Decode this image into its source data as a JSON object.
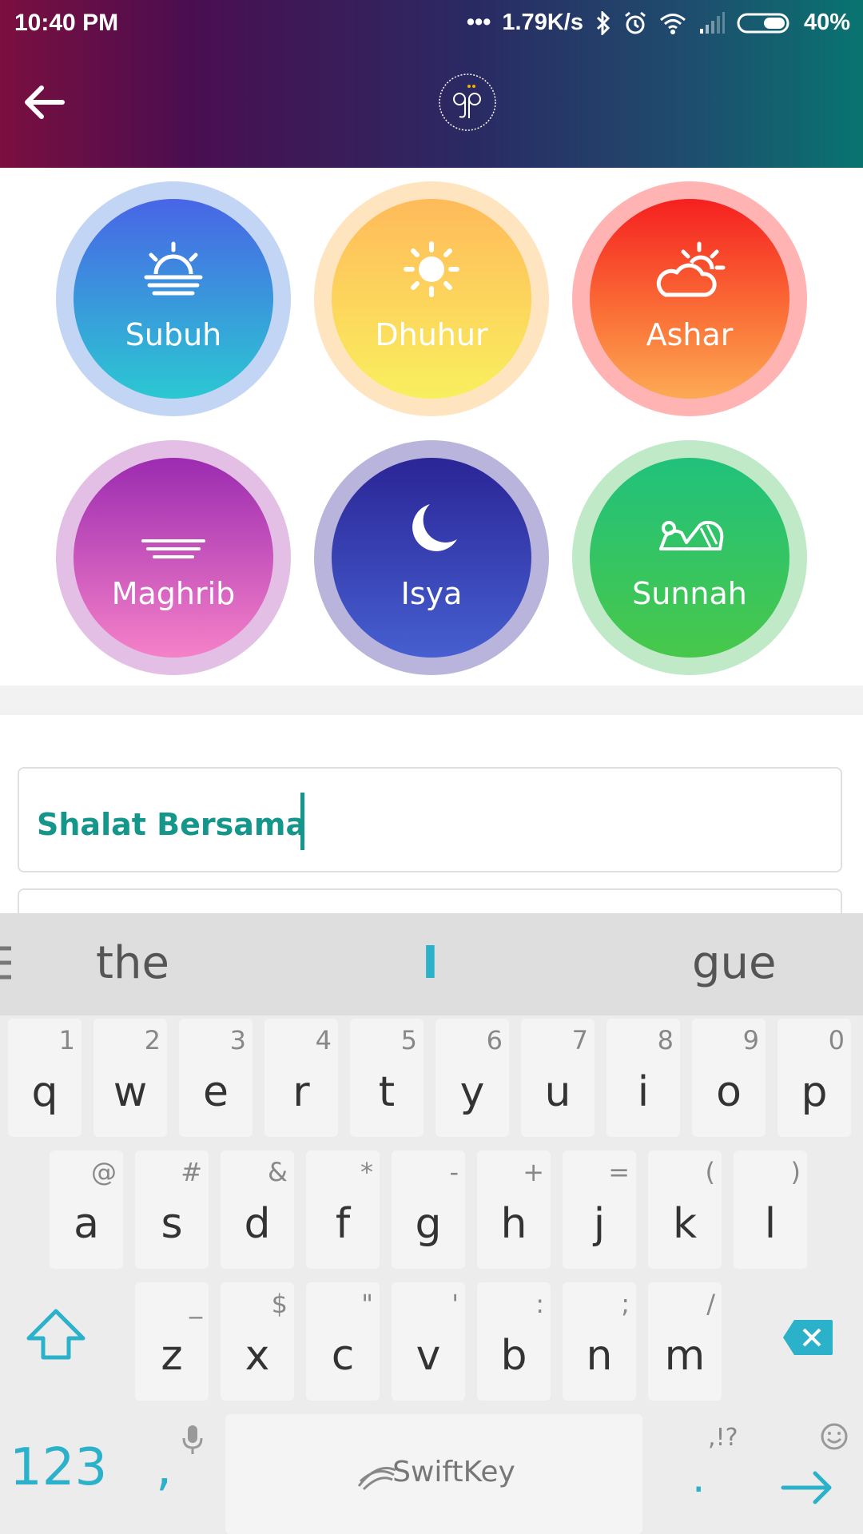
{
  "status_bar": {
    "time": "10:40 PM",
    "speed": "1.79K/s",
    "battery": "40%"
  },
  "header": {
    "back_icon": "arrow-left-icon",
    "logo": "gp"
  },
  "prayers": [
    {
      "label": "Subuh",
      "icon": "sunrise-icon"
    },
    {
      "label": "Dhuhur",
      "icon": "sun-icon"
    },
    {
      "label": "Ashar",
      "icon": "sun-cloud-icon"
    },
    {
      "label": "Maghrib",
      "icon": "moonset-icon"
    },
    {
      "label": "Isya",
      "icon": "moon-icon"
    },
    {
      "label": "Sunnah",
      "icon": "prostration-icon"
    }
  ],
  "input": {
    "label": "Shalat Bersama",
    "value": ""
  },
  "keyboard": {
    "suggestions": [
      "the",
      "I",
      "gue"
    ],
    "row1": [
      {
        "key": "q",
        "hint": "1"
      },
      {
        "key": "w",
        "hint": "2"
      },
      {
        "key": "e",
        "hint": "3"
      },
      {
        "key": "r",
        "hint": "4"
      },
      {
        "key": "t",
        "hint": "5"
      },
      {
        "key": "y",
        "hint": "6"
      },
      {
        "key": "u",
        "hint": "7"
      },
      {
        "key": "i",
        "hint": "8"
      },
      {
        "key": "o",
        "hint": "9"
      },
      {
        "key": "p",
        "hint": "0"
      }
    ],
    "row2": [
      {
        "key": "a",
        "hint": "@"
      },
      {
        "key": "s",
        "hint": "#"
      },
      {
        "key": "d",
        "hint": "&"
      },
      {
        "key": "f",
        "hint": "*"
      },
      {
        "key": "g",
        "hint": "-"
      },
      {
        "key": "h",
        "hint": "+"
      },
      {
        "key": "j",
        "hint": "="
      },
      {
        "key": "k",
        "hint": "("
      },
      {
        "key": "l",
        "hint": ")"
      }
    ],
    "row3": [
      {
        "key": "z",
        "hint": "_"
      },
      {
        "key": "x",
        "hint": "$"
      },
      {
        "key": "c",
        "hint": "\""
      },
      {
        "key": "v",
        "hint": "'"
      },
      {
        "key": "b",
        "hint": ":"
      },
      {
        "key": "n",
        "hint": ";"
      },
      {
        "key": "m",
        "hint": "/"
      }
    ],
    "numbers_label": "123",
    "comma": ",",
    "space_brand": "SwiftKey",
    "period": ".",
    "period_hint": ",!?",
    "colors": {
      "accent": "#2bb1c9"
    }
  }
}
